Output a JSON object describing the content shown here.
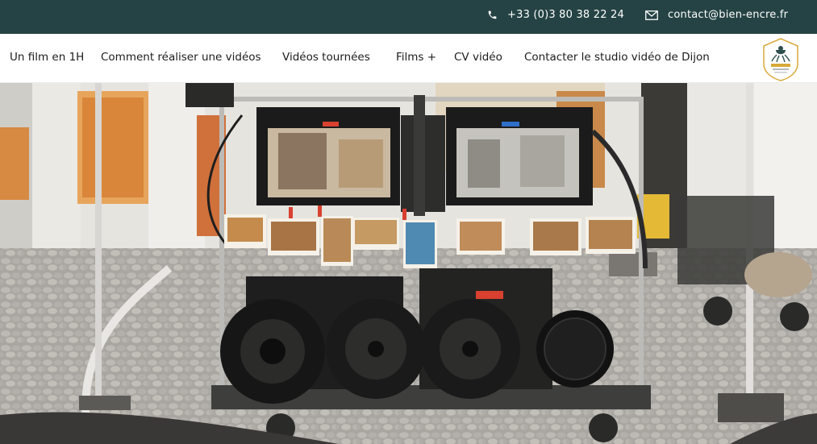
{
  "topbar": {
    "phone": "+33 (0)3 80 38 22 24",
    "email": "contact@bien-encre.fr",
    "phone_icon": "phone-icon",
    "email_icon": "envelope-icon"
  },
  "nav": {
    "items": [
      {
        "label": "Un film en 1H"
      },
      {
        "label": "Comment réaliser une vidéos"
      },
      {
        "label": "Vidéos tournées"
      },
      {
        "label": "Films +"
      },
      {
        "label": "CV vidéo"
      },
      {
        "label": "Contacter le studio vidéo de Dijon"
      }
    ]
  },
  "logo": {
    "text": "Bien encré"
  },
  "hero": {
    "description_icon": "film-set-photo"
  },
  "colors": {
    "topbar_bg": "#254344",
    "nav_text": "#1c1c1c",
    "logo_gold": "#d9a93a"
  }
}
